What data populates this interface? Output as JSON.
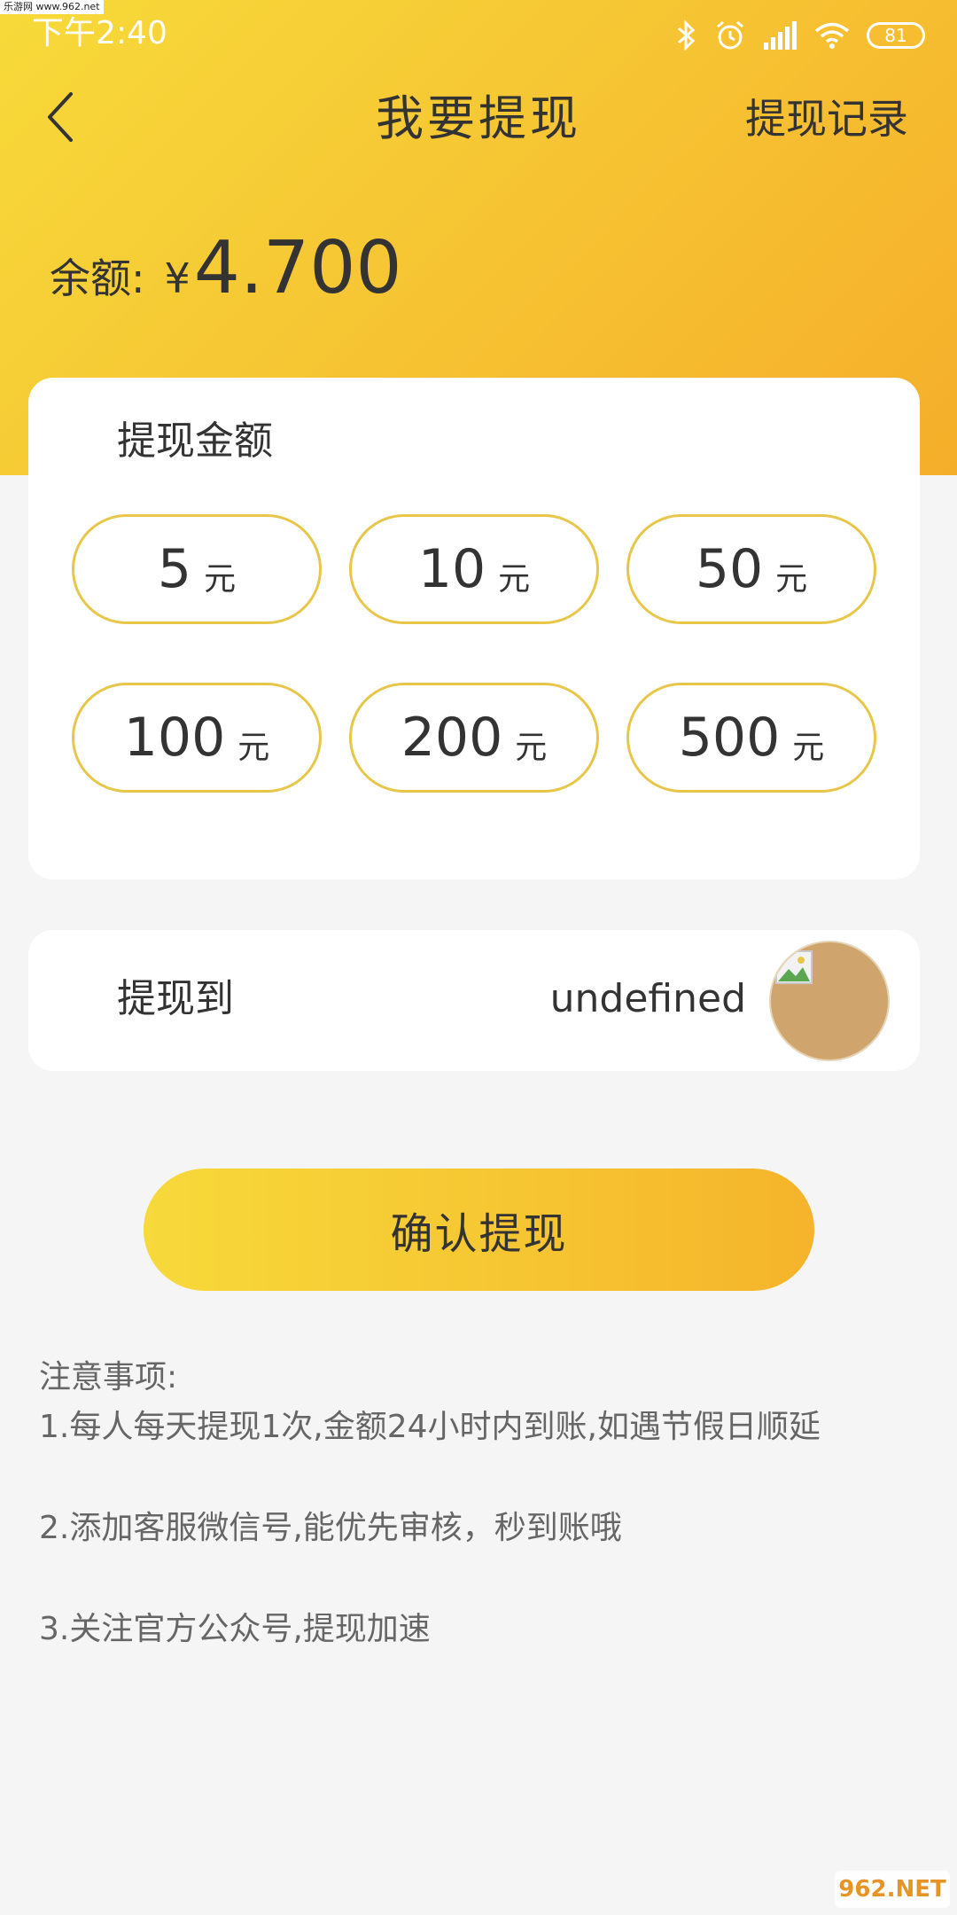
{
  "watermark_top": "乐游网 www.962.net",
  "status_bar": {
    "time": "下午2:40",
    "battery": "81",
    "icons": [
      "bluetooth-icon",
      "alarm-icon",
      "signal-icon",
      "wifi-icon",
      "battery-icon"
    ]
  },
  "nav": {
    "title": "我要提现",
    "record_label": "提现记录",
    "back_icon": "chevron-left-icon"
  },
  "balance": {
    "label": "余额:",
    "currency": "¥",
    "amount": "4.700"
  },
  "amount_card": {
    "title": "提现金额",
    "unit": "元",
    "options": [
      {
        "value": "5",
        "unit": "元"
      },
      {
        "value": "10",
        "unit": "元"
      },
      {
        "value": "50",
        "unit": "元"
      },
      {
        "value": "100",
        "unit": "元"
      },
      {
        "value": "200",
        "unit": "元"
      },
      {
        "value": "500",
        "unit": "元"
      }
    ]
  },
  "target_card": {
    "label": "提现到",
    "value": "undefined"
  },
  "confirm_label": "确认提现",
  "notes": {
    "title": "注意事项:",
    "items": [
      "1.每人每天提现1次,金额24小时内到账,如遇节假日顺延",
      "2.添加客服微信号,能优先审核，秒到账哦",
      "3.关注官方公众号,提现加速"
    ]
  },
  "watermark_bottom": "962.NET",
  "colors": {
    "header_gradient_start": "#f7da3a",
    "header_gradient_end": "#f5ae2a",
    "option_border": "#e8c64a",
    "avatar_fill": "#cfa56d",
    "page_bg": "#f5f5f5"
  }
}
